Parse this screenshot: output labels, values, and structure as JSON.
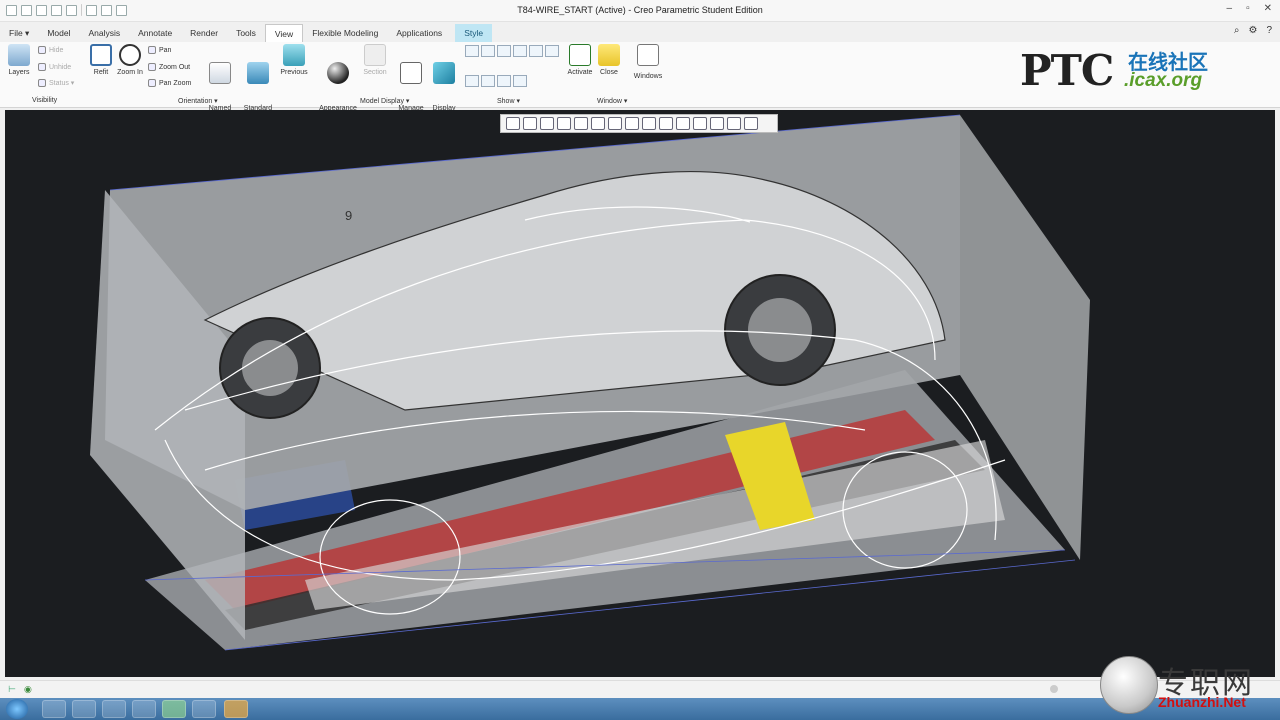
{
  "window": {
    "title": "T84-WIRE_START (Active) - Creo Parametric Student Edition"
  },
  "menubar": {
    "tabs": [
      {
        "label": "File ▾"
      },
      {
        "label": "Model"
      },
      {
        "label": "Analysis"
      },
      {
        "label": "Annotate"
      },
      {
        "label": "Render"
      },
      {
        "label": "Tools"
      },
      {
        "label": "View"
      },
      {
        "label": "Flexible Modeling"
      },
      {
        "label": "Applications"
      },
      {
        "label": "Style"
      }
    ]
  },
  "ribbon": {
    "visibility": {
      "layers": "Layers",
      "hide": "Hide",
      "unhide": "Unhide",
      "status": "Status ▾",
      "group": "Visibility"
    },
    "orientation": {
      "refit": "Refit",
      "zoom_in": "Zoom In",
      "pan": "Pan",
      "zoom_out": "Zoom Out",
      "pan_zoom": "Pan Zoom",
      "named_views": "Named\nViews ▾",
      "standard_orientation": "Standard\nOrientation",
      "previous": "Previous",
      "group": "Orientation ▾"
    },
    "model_display": {
      "appearance_gallery": "Appearance\nGallery ▾",
      "section": "Section",
      "manage_views": "Manage\nViews ▾",
      "display_style": "Display\nStyle ▾",
      "group": "Model Display ▾"
    },
    "show": {
      "group": "Show ▾"
    },
    "window": {
      "activate": "Activate",
      "close": "Close",
      "windows": "Windows",
      "group": "Window ▾"
    }
  },
  "logo": {
    "brand": "PTC",
    "cn": "在线社区",
    "site": ".icax.org"
  },
  "viewport": {
    "label_nine": "9"
  },
  "watermark": {
    "cn": "专职网",
    "url": "Zhuanzhi.Net"
  },
  "colors": {
    "viewport_bg": "#1b1d20",
    "style_tab": "#bfe6f4",
    "accent_blue": "#1a74b8"
  }
}
